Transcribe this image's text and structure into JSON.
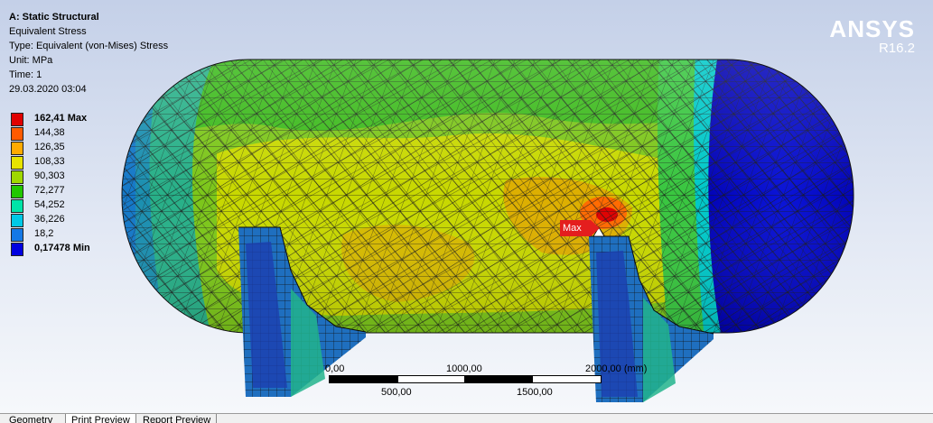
{
  "info": {
    "title": "A: Static Structural",
    "result": "Equivalent Stress",
    "type": "Type: Equivalent (von-Mises) Stress",
    "unit": "Unit: MPa",
    "time": "Time: 1",
    "date": "29.03.2020 03:04"
  },
  "brand": {
    "name": "ANSYS",
    "version": "R16.2"
  },
  "legend": [
    {
      "label": "162,41 Max",
      "color": "#e00000",
      "bold": true
    },
    {
      "label": "144,38",
      "color": "#ff5a00",
      "bold": false
    },
    {
      "label": "126,35",
      "color": "#ffaa00",
      "bold": false
    },
    {
      "label": "108,33",
      "color": "#e8e400",
      "bold": false
    },
    {
      "label": "90,303",
      "color": "#9fd800",
      "bold": false
    },
    {
      "label": "72,277",
      "color": "#22c800",
      "bold": false
    },
    {
      "label": "54,252",
      "color": "#00e4a8",
      "bold": false
    },
    {
      "label": "36,226",
      "color": "#00c8e6",
      "bold": false
    },
    {
      "label": "18,2",
      "color": "#1478e6",
      "bold": false
    },
    {
      "label": "0,17478 Min",
      "color": "#0000e0",
      "bold": true
    }
  ],
  "probe": {
    "label": "Max"
  },
  "scale": {
    "top_labels": [
      "0,00",
      "1000,00",
      "2000,00 (mm)"
    ],
    "bottom_labels": [
      "500,00",
      "1500,00"
    ]
  },
  "tabs": [
    "Geometry",
    "Print Preview",
    "Report Preview"
  ],
  "colors": {
    "mesh": "#1a1a1a",
    "hot": "#e00000",
    "cold": "#0000e0"
  }
}
